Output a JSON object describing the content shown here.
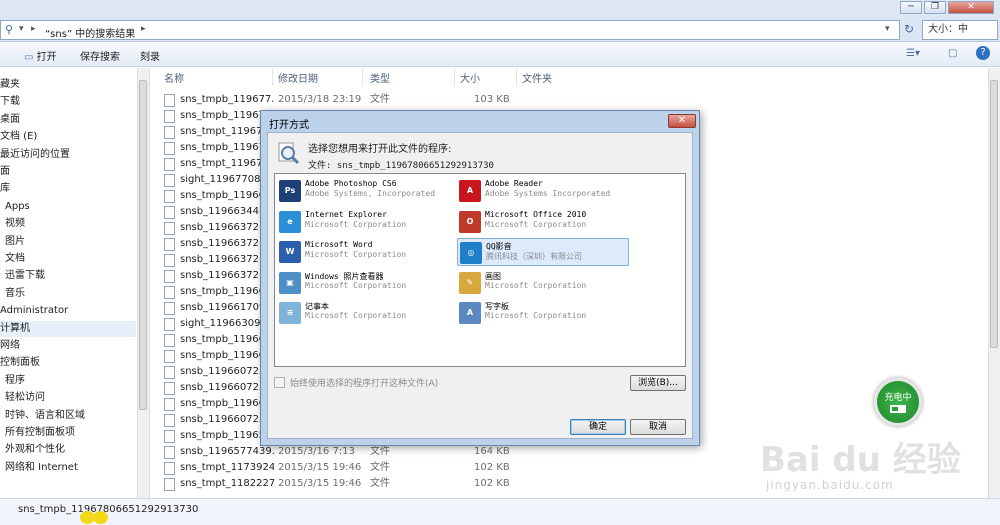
{
  "address": {
    "path": "“sns” 中的搜索结果",
    "search_value": "大小：中"
  },
  "toolbar": {
    "open": "打开",
    "save_search": "保存搜索",
    "burn": "刻录"
  },
  "nav": {
    "items": [
      "藏夹",
      "下载",
      "桌面",
      "文档 (E)",
      "最近访问的位置",
      "面",
      "库",
      "Apps",
      "视频",
      "图片",
      "文档",
      "迅雷下载",
      "音乐",
      "Administrator",
      "计算机",
      "网络",
      "控制面板",
      "程序",
      "轻松访问",
      "时钟、语言和区域",
      "所有控制面板项",
      "外观和个性化",
      "网络和 Internet"
    ]
  },
  "columns": {
    "name": "名称",
    "date": "修改日期",
    "type": "类型",
    "size": "大小",
    "folder": "文件夹"
  },
  "files": [
    {
      "name": "sns_tmpb_119677...",
      "date": "2015/3/18 23:19",
      "type": "文件",
      "size": "103 KB"
    },
    {
      "name": "sns_tmpb_1196780",
      "date": "",
      "type": "",
      "size": ""
    },
    {
      "name": "sns_tmpt_1196780",
      "date": "",
      "type": "",
      "size": ""
    },
    {
      "name": "sns_tmpb_1196780",
      "date": "",
      "type": "",
      "size": ""
    },
    {
      "name": "sns_tmpt_1196780",
      "date": "",
      "type": "",
      "size": ""
    },
    {
      "name": "sight_1196770811",
      "date": "",
      "type": "",
      "size": ""
    },
    {
      "name": "sns_tmpb_1196630",
      "date": "",
      "type": "",
      "size": ""
    },
    {
      "name": "snsb_1196634433",
      "date": "",
      "type": "",
      "size": ""
    },
    {
      "name": "snsb_1196637216",
      "date": "",
      "type": "",
      "size": ""
    },
    {
      "name": "snsb_1196637216",
      "date": "",
      "type": "",
      "size": ""
    },
    {
      "name": "snsb_1196637216",
      "date": "",
      "type": "",
      "size": ""
    },
    {
      "name": "snsb_1196637216",
      "date": "",
      "type": "",
      "size": ""
    },
    {
      "name": "sns_tmpb_1196610",
      "date": "",
      "type": "",
      "size": ""
    },
    {
      "name": "snsb_1196617098",
      "date": "",
      "type": "",
      "size": ""
    },
    {
      "name": "sight_1196630919",
      "date": "",
      "type": "",
      "size": ""
    },
    {
      "name": "sns_tmpb_1196600",
      "date": "",
      "type": "",
      "size": ""
    },
    {
      "name": "sns_tmpb_1196600",
      "date": "",
      "type": "",
      "size": ""
    },
    {
      "name": "snsb_1196607255",
      "date": "",
      "type": "",
      "size": ""
    },
    {
      "name": "snsb_1196607255",
      "date": "",
      "type": "",
      "size": ""
    },
    {
      "name": "sns_tmpb_1196600",
      "date": "",
      "type": "",
      "size": ""
    },
    {
      "name": "snsb_1196607255",
      "date": "",
      "type": "",
      "size": ""
    },
    {
      "name": "sns_tmpb_1196570",
      "date": "",
      "type": "",
      "size": ""
    },
    {
      "name": "snsb_1196577439...",
      "date": "2015/3/16 7:13",
      "type": "文件",
      "size": "164 KB"
    },
    {
      "name": "sns_tmpt_1173924...",
      "date": "2015/3/15 19:46",
      "type": "文件",
      "size": "102 KB"
    },
    {
      "name": "sns_tmpt_1182227...",
      "date": "2015/3/15 19:46",
      "type": "文件",
      "size": "102 KB"
    }
  ],
  "status": {
    "selected_file": "sns_tmpb_1196780665129291373​0"
  },
  "dialog": {
    "title": "打开方式",
    "prompt": "选择您想用来打开此文件的程序:",
    "file_label": "文件:  sns_tmpb_1196780665129291373​0",
    "programs": [
      {
        "name": "Adobe Photoshop CS6",
        "company": "Adobe Systems, Incorporated",
        "icon": "photoshop-icon",
        "color": "#1d3f77",
        "glyph": "Ps"
      },
      {
        "name": "Adobe Reader",
        "company": "Adobe Systems Incorporated",
        "icon": "adobe-reader-icon",
        "color": "#c8161d",
        "glyph": "A"
      },
      {
        "name": "Internet Explorer",
        "company": "Microsoft Corporation",
        "icon": "internet-explorer-icon",
        "color": "#2a8fd6",
        "glyph": "e"
      },
      {
        "name": "Microsoft Office 2010",
        "company": "Microsoft Corporation",
        "icon": "office-icon",
        "color": "#c0392b",
        "glyph": "O"
      },
      {
        "name": "Microsoft Word",
        "company": "Microsoft Corporation",
        "icon": "word-icon",
        "color": "#2b5fab",
        "glyph": "W"
      },
      {
        "name": "QQ影音",
        "company": "腾讯科技（深圳）有限公司",
        "icon": "qq-player-icon",
        "color": "#1f7fc7",
        "glyph": "◎"
      },
      {
        "name": "Windows 照片查看器",
        "company": "Microsoft Corporation",
        "icon": "photo-viewer-icon",
        "color": "#4f8fc7",
        "glyph": "▣"
      },
      {
        "name": "画图",
        "company": "Microsoft Corporation",
        "icon": "paint-icon",
        "color": "#d9a83c",
        "glyph": "✎"
      },
      {
        "name": "记事本",
        "company": "Microsoft Corporation",
        "icon": "notepad-icon",
        "color": "#7fb3d9",
        "glyph": "≡"
      },
      {
        "name": "写字板",
        "company": "Microsoft Corporation",
        "icon": "wordpad-icon",
        "color": "#5b88c0",
        "glyph": "A"
      }
    ],
    "always_use": "始终使用选择的程序打开这种文件(A)",
    "browse": "浏览(B)...",
    "ok": "确定",
    "cancel": "取消"
  },
  "battery_badge": "充电中",
  "watermark": {
    "main": "Bai du 经验",
    "sub": "jingyan.baidu.com"
  }
}
